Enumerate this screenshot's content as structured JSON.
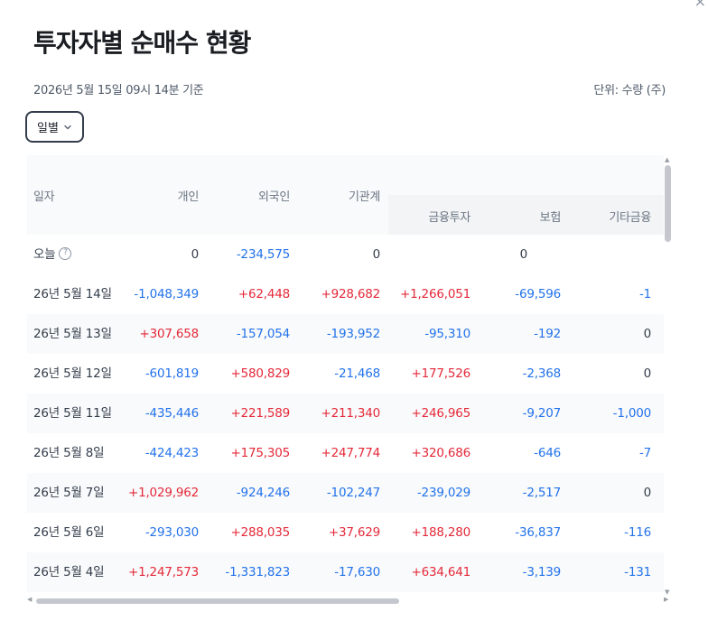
{
  "page": {
    "title": "투자자별 순매수 현황",
    "as_of": "2026년 5월 15일 09시 14분 기준",
    "unit": "단위: 수량 (주)",
    "close_label": "×",
    "period_select": "일별"
  },
  "table": {
    "headers": {
      "date": "일자",
      "individual": "개인",
      "foreign": "외국인",
      "institution": "기관계",
      "financial_investment": "금융투자",
      "insurance": "보험",
      "other_finance": "기타금융"
    },
    "today": {
      "date": "오늘",
      "help_icon": "question-circle-icon",
      "individual": "0",
      "foreign": "-234,575",
      "institution": "0",
      "financial_investment": "0"
    },
    "rows": [
      {
        "date": "26년 5월 14일",
        "individual": "-1,048,349",
        "foreign": "+62,448",
        "institution": "+928,682",
        "financial_investment": "+1,266,051",
        "insurance": "-69,596",
        "other_finance": "-1"
      },
      {
        "date": "26년 5월 13일",
        "individual": "+307,658",
        "foreign": "-157,054",
        "institution": "-193,952",
        "financial_investment": "-95,310",
        "insurance": "-192",
        "other_finance": "0"
      },
      {
        "date": "26년 5월 12일",
        "individual": "-601,819",
        "foreign": "+580,829",
        "institution": "-21,468",
        "financial_investment": "+177,526",
        "insurance": "-2,368",
        "other_finance": "0"
      },
      {
        "date": "26년 5월 11일",
        "individual": "-435,446",
        "foreign": "+221,589",
        "institution": "+211,340",
        "financial_investment": "+246,965",
        "insurance": "-9,207",
        "other_finance": "-1,000"
      },
      {
        "date": "26년 5월 8일",
        "individual": "-424,423",
        "foreign": "+175,305",
        "institution": "+247,774",
        "financial_investment": "+320,686",
        "insurance": "-646",
        "other_finance": "-7"
      },
      {
        "date": "26년 5월 7일",
        "individual": "+1,029,962",
        "foreign": "-924,246",
        "institution": "-102,247",
        "financial_investment": "-239,029",
        "insurance": "-2,517",
        "other_finance": "0"
      },
      {
        "date": "26년 5월 6일",
        "individual": "-293,030",
        "foreign": "+288,035",
        "institution": "+37,629",
        "financial_investment": "+188,280",
        "insurance": "-36,837",
        "other_finance": "-116"
      },
      {
        "date": "26년 5월 4일",
        "individual": "+1,247,573",
        "foreign": "-1,331,823",
        "institution": "-17,630",
        "financial_investment": "+634,641",
        "insurance": "-3,139",
        "other_finance": "-131"
      }
    ]
  },
  "colors": {
    "positive": "#e42939",
    "negative": "#2272eb",
    "neutral": "#333d4b"
  }
}
